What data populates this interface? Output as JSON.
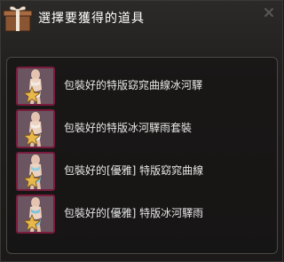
{
  "window": {
    "title": "選擇要獲得的道具"
  },
  "items": [
    {
      "label": "包裝好的特版窈窕曲線冰河驛",
      "swimsuit_color": "#e7d6c8"
    },
    {
      "label": "包裝好的特版冰河驛雨套裝",
      "swimsuit_color": "#e8d8cc"
    },
    {
      "label": "包裝好的[優雅] 特版窈窕曲線",
      "swimsuit_color": "#8fcde0"
    },
    {
      "label": "包裝好的[優雅] 特版冰河驛雨",
      "swimsuit_color": "#7fc2dc"
    }
  ],
  "icons": {
    "title": "gift-box-icon",
    "close": "close-icon",
    "item": "swimsuit-icon",
    "badge": "star-icon"
  },
  "colors": {
    "slot_border": "#7a1c3e",
    "star": "#e8b84a",
    "label_text": "#e6e6e6"
  }
}
